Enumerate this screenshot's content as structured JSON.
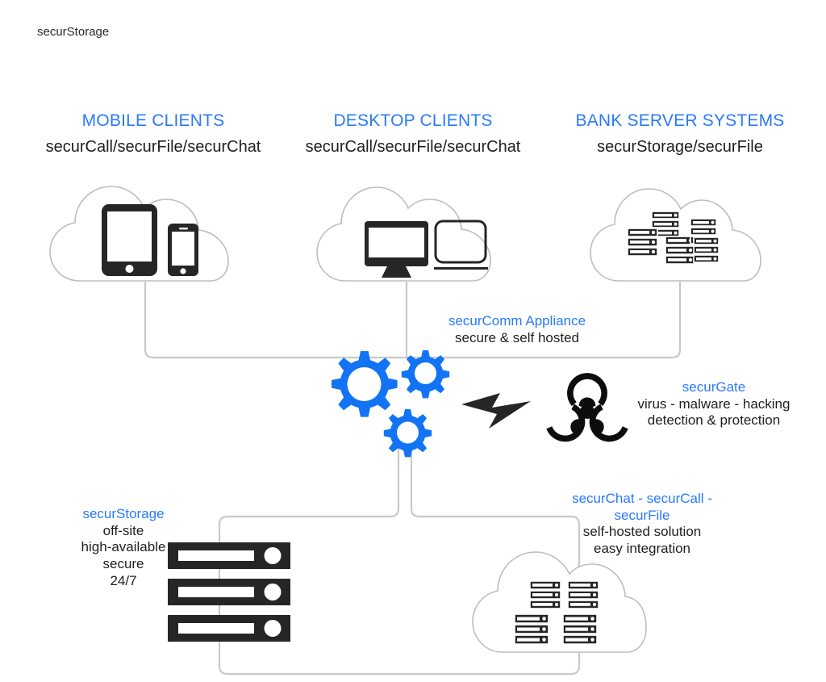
{
  "page": {
    "watermark": "securStorage",
    "background_color": "#ffffff",
    "accent_color": "#2979ff",
    "line_color": "#c9c9c9",
    "icon_color": "#262626"
  },
  "top_nodes": [
    {
      "id": "mobile-clients",
      "title": "MOBILE CLIENTS",
      "subtitle": "securCall/securFile/securChat",
      "icon": "cloud-with-tablet-and-phone-icon"
    },
    {
      "id": "desktop-clients",
      "title": "DESKTOP CLIENTS",
      "subtitle": "securCall/securFile/securChat",
      "icon": "cloud-with-monitor-and-laptop-icon"
    },
    {
      "id": "bank-server-systems",
      "title": "BANK SERVER SYSTEMS",
      "subtitle": "securStorage/securFile",
      "icon": "cloud-with-server-racks-icon"
    }
  ],
  "appliance": {
    "title": "securComm Appliance",
    "description": "secure & self hosted",
    "icon": "gears-icon"
  },
  "gate": {
    "title": "securGate",
    "line1": "virus - malware - hacking",
    "line2": "detection & protection",
    "icon": "biohazard-icon",
    "bolt_icon": "lightning-bolt-icon"
  },
  "storage": {
    "title": "securStorage",
    "line1": "off-site",
    "line2": "high-available",
    "line3": "secure",
    "line4": "24/7",
    "icon": "server-stack-icon"
  },
  "services": {
    "title_line1": "securChat - securCall -",
    "title_line2": "securFile",
    "line1": "self-hosted solution",
    "line2": "easy integration",
    "icon": "cloud-with-server-racks-icon"
  }
}
